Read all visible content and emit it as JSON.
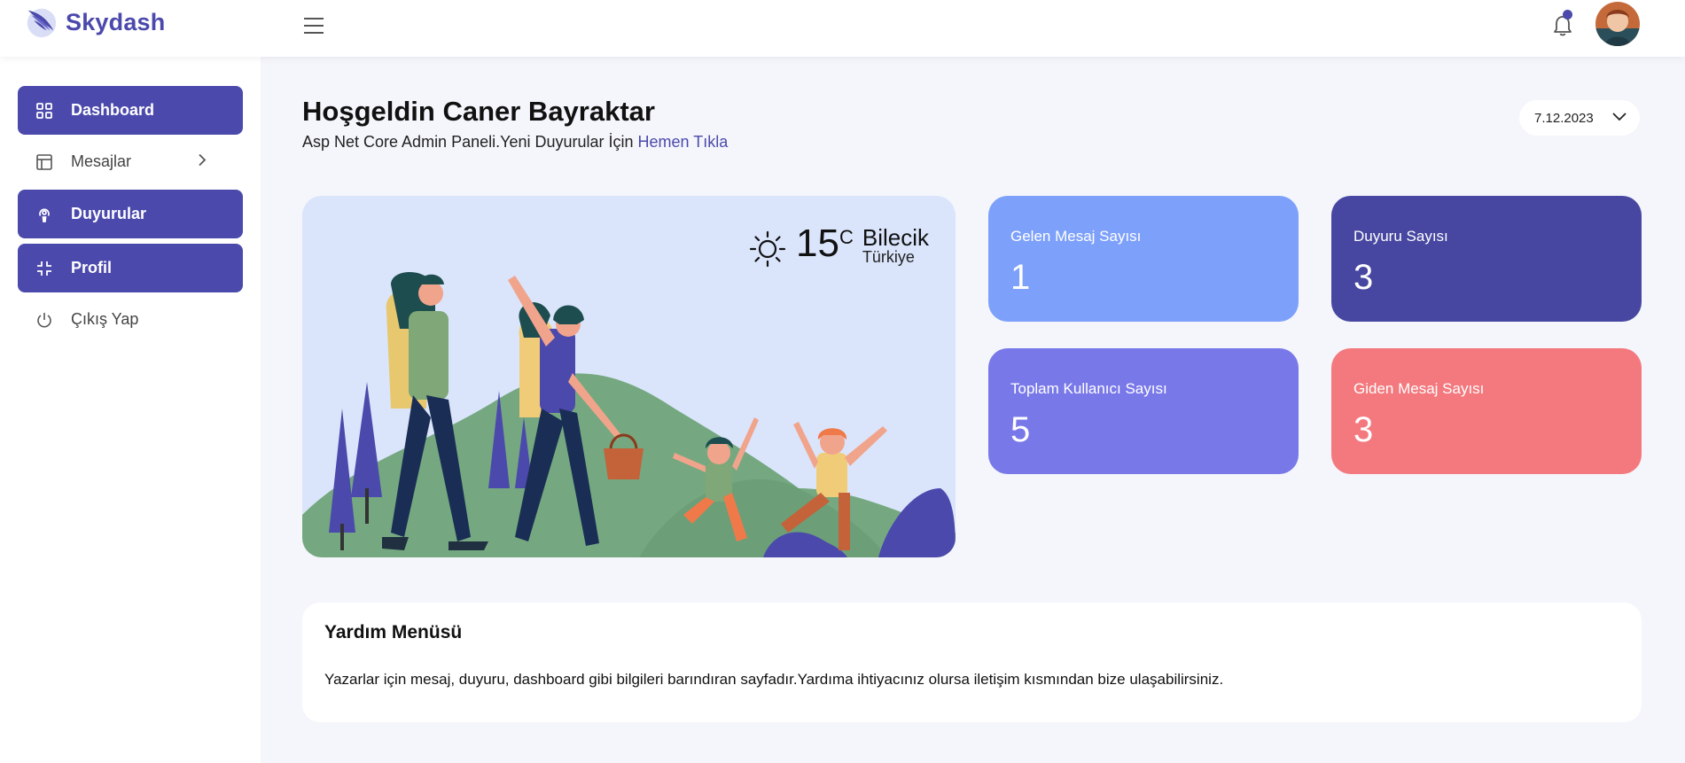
{
  "app": {
    "brand": "Skydash"
  },
  "colors": {
    "primary": "#4b49ac",
    "incoming": "#7da0fa",
    "announcements": "#4747a1",
    "users": "#7978e9",
    "outgoing": "#f3797e"
  },
  "sidebar": {
    "items": [
      {
        "label": "Dashboard",
        "icon": "grid-icon",
        "active": true
      },
      {
        "label": "Mesajlar",
        "icon": "layout-icon",
        "active": false,
        "chevron": true
      },
      {
        "label": "Duyurular",
        "icon": "podcast-icon",
        "active": true
      },
      {
        "label": "Profil",
        "icon": "minimize-icon",
        "active": true
      },
      {
        "label": "Çıkış Yap",
        "icon": "power-icon",
        "active": false
      }
    ]
  },
  "header": {
    "welcome": "Hoşgeldin Caner Bayraktar",
    "subtitle": "Asp Net Core Admin Paneli.Yeni Duyurular İçin",
    "link": "Hemen Tıkla",
    "date": "7.12.2023"
  },
  "weather": {
    "temp": "15",
    "unit": "C",
    "city": "Bilecik",
    "country": "Türkiye",
    "icon": "sun-icon"
  },
  "stats": [
    {
      "title": "Gelen Mesaj Sayısı",
      "value": "1"
    },
    {
      "title": "Duyuru Sayısı",
      "value": "3"
    },
    {
      "title": "Toplam Kullanıcı Sayısı",
      "value": "5"
    },
    {
      "title": "Giden Mesaj Sayısı",
      "value": "3"
    }
  ],
  "help": {
    "title": "Yardım Menüsü",
    "text": "Yazarlar için mesaj, duyuru, dashboard gibi bilgileri barındıran sayfadır.Yardıma ihtiyacınız olursa iletişim kısmından bize ulaşabilirsiniz."
  }
}
